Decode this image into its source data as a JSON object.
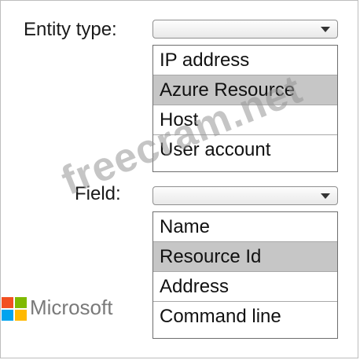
{
  "entity": {
    "label": "Entity type:",
    "options": [
      "IP address",
      "Azure Resource",
      "Host",
      "User account"
    ],
    "selected_index": 1
  },
  "field": {
    "label": "Field:",
    "options": [
      "Name",
      "Resource Id",
      "Address",
      "Command line"
    ],
    "selected_index": 1
  },
  "watermark": "freecram.net",
  "brand": {
    "name": "Microsoft",
    "logo_colors": [
      "#f25022",
      "#7fba00",
      "#00a4ef",
      "#ffb900"
    ]
  },
  "colors": {
    "selected_bg": "#c6c6c6",
    "border": "#6e6e6e"
  }
}
